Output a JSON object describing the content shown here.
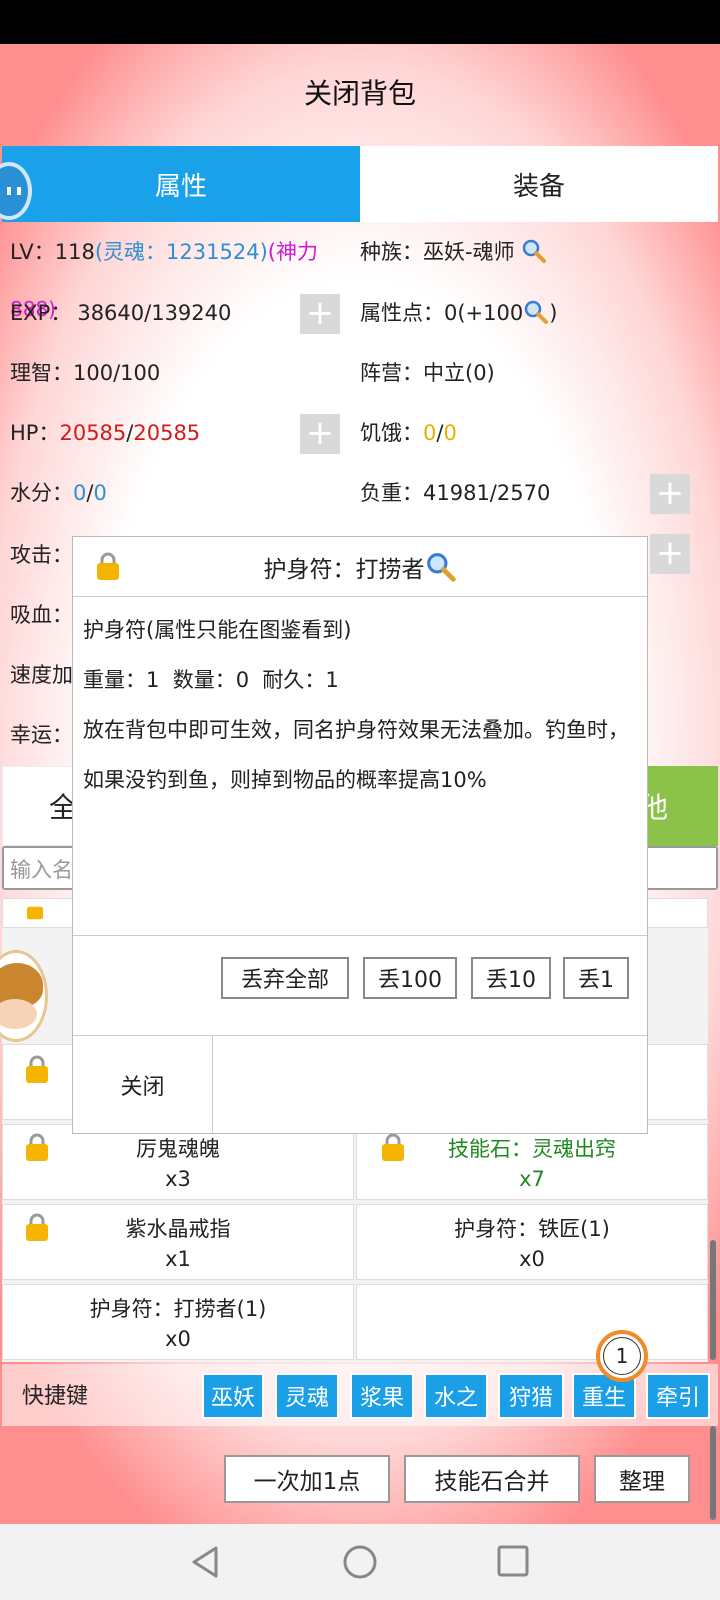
{
  "header": {
    "title": "关闭背包"
  },
  "tabs": {
    "attributes": "属性",
    "equipment": "装备"
  },
  "stats": {
    "lv_label": "LV：",
    "lv_value": "118",
    "lv_soul": "(灵魂：1231524)",
    "lv_divine": "(神力",
    "exp_label": "EXP：",
    "exp_value": "38640/139240",
    "exp_overlay": "888)",
    "sanity_label": "理智：",
    "sanity_value": "100/100",
    "hp_label": "HP：",
    "hp_cur": "20585",
    "hp_sep": "/",
    "hp_max": "20585",
    "water_label": "水分：",
    "water_cur": "0",
    "water_sep": "/",
    "water_max": "0",
    "race_label": "种族：",
    "race_value": "巫妖-魂师",
    "points_label": "属性点：",
    "points_value": "0(+100",
    "points_tail": ")",
    "camp_label": "阵营：",
    "camp_value": "中立(0)",
    "hunger_label": "饥饿：",
    "hunger_cur": "0",
    "hunger_sep": "/",
    "hunger_max": "0",
    "load_label": "负重：",
    "load_value": "41981/2570",
    "attack_label": "攻击：",
    "lifesteal_label": "吸血：",
    "speed_label": "速度加",
    "luck_label": "幸运：",
    "plus": "+"
  },
  "partial": {
    "left_btn": "全",
    "right_btn": "他",
    "search_placeholder": "输入名"
  },
  "dialog": {
    "title": "护身符：打捞者",
    "line1": "护身符(属性只能在图鉴看到)",
    "line2": "重量：1  数量：0  耐久：1",
    "line3": "放在背包中即可生效，同名护身符效果无法叠加。钓鱼时，如果没钓到鱼，则掉到物品的概率提高10%",
    "btn_discard_all": "丢弃全部",
    "btn_discard_100": "丢100",
    "btn_discard_10": "丢10",
    "btn_discard_1": "丢1",
    "close": "关闭"
  },
  "items": [
    {
      "name": "厉鬼魂魄",
      "qty": "x3"
    },
    {
      "name": "技能石：灵魂出窍",
      "qty": "x7"
    },
    {
      "name": "紫水晶戒指",
      "qty": "x1"
    },
    {
      "name": "护身符：铁匠(1)",
      "qty": "x0"
    },
    {
      "name": "护身符：打捞者(1)",
      "qty": "x0"
    }
  ],
  "shortcuts": {
    "label": "快捷键",
    "skills": [
      "巫妖",
      "灵魂",
      "浆果",
      "水之",
      "狩猎",
      "重生",
      "牵引"
    ],
    "badge": "1"
  },
  "bottom": {
    "add_one": "一次加1点",
    "merge": "技能石合并",
    "sort": "整理"
  },
  "colors": {
    "accent": "#19a2ea",
    "green": "#8bc34a",
    "item_green": "#1f8a1f",
    "hp_red": "#d21c1c",
    "mp_blue": "#2f8fd0",
    "divine_magenta": "#d11ad1",
    "hunger_yellow": "#e8b100"
  },
  "icons": [
    "lock-icon",
    "magnifier-icon",
    "back-icon",
    "home-icon",
    "recents-icon",
    "floating-chat-icon",
    "avatar-icon"
  ]
}
